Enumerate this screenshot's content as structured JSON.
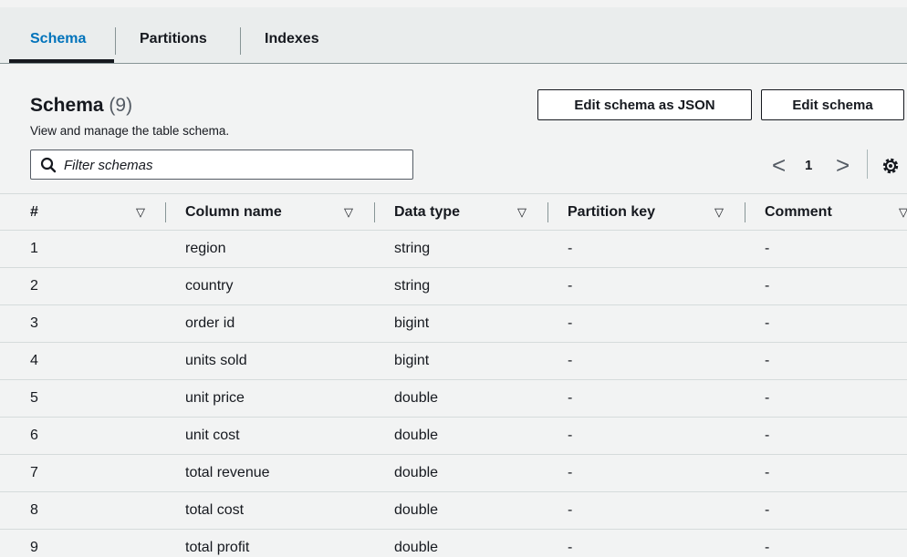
{
  "tabs": [
    {
      "label": "Schema",
      "active": true
    },
    {
      "label": "Partitions",
      "active": false
    },
    {
      "label": "Indexes",
      "active": false
    }
  ],
  "header": {
    "title": "Schema",
    "count": "(9)",
    "subtitle": "View and manage the table schema.",
    "edit_json_label": "Edit schema as JSON",
    "edit_label": "Edit schema"
  },
  "search": {
    "placeholder": "Filter schemas"
  },
  "pagination": {
    "prev": "<",
    "page": "1",
    "next": ">"
  },
  "table": {
    "columns": [
      "#",
      "Column name",
      "Data type",
      "Partition key",
      "Comment"
    ],
    "rows": [
      [
        "1",
        "region",
        "string",
        "-",
        "-"
      ],
      [
        "2",
        "country",
        "string",
        "-",
        "-"
      ],
      [
        "3",
        "order id",
        "bigint",
        "-",
        "-"
      ],
      [
        "4",
        "units sold",
        "bigint",
        "-",
        "-"
      ],
      [
        "5",
        "unit price",
        "double",
        "-",
        "-"
      ],
      [
        "6",
        "unit cost",
        "double",
        "-",
        "-"
      ],
      [
        "7",
        "total revenue",
        "double",
        "-",
        "-"
      ],
      [
        "8",
        "total cost",
        "double",
        "-",
        "-"
      ],
      [
        "9",
        "total profit",
        "double",
        "-",
        "-"
      ]
    ]
  },
  "icons": {
    "search": "search-icon",
    "settings": "gear-icon",
    "sort": "sort-caret-icon"
  },
  "colors": {
    "accent": "#0073bb",
    "text": "#16191f",
    "background": "#f2f3f3"
  }
}
